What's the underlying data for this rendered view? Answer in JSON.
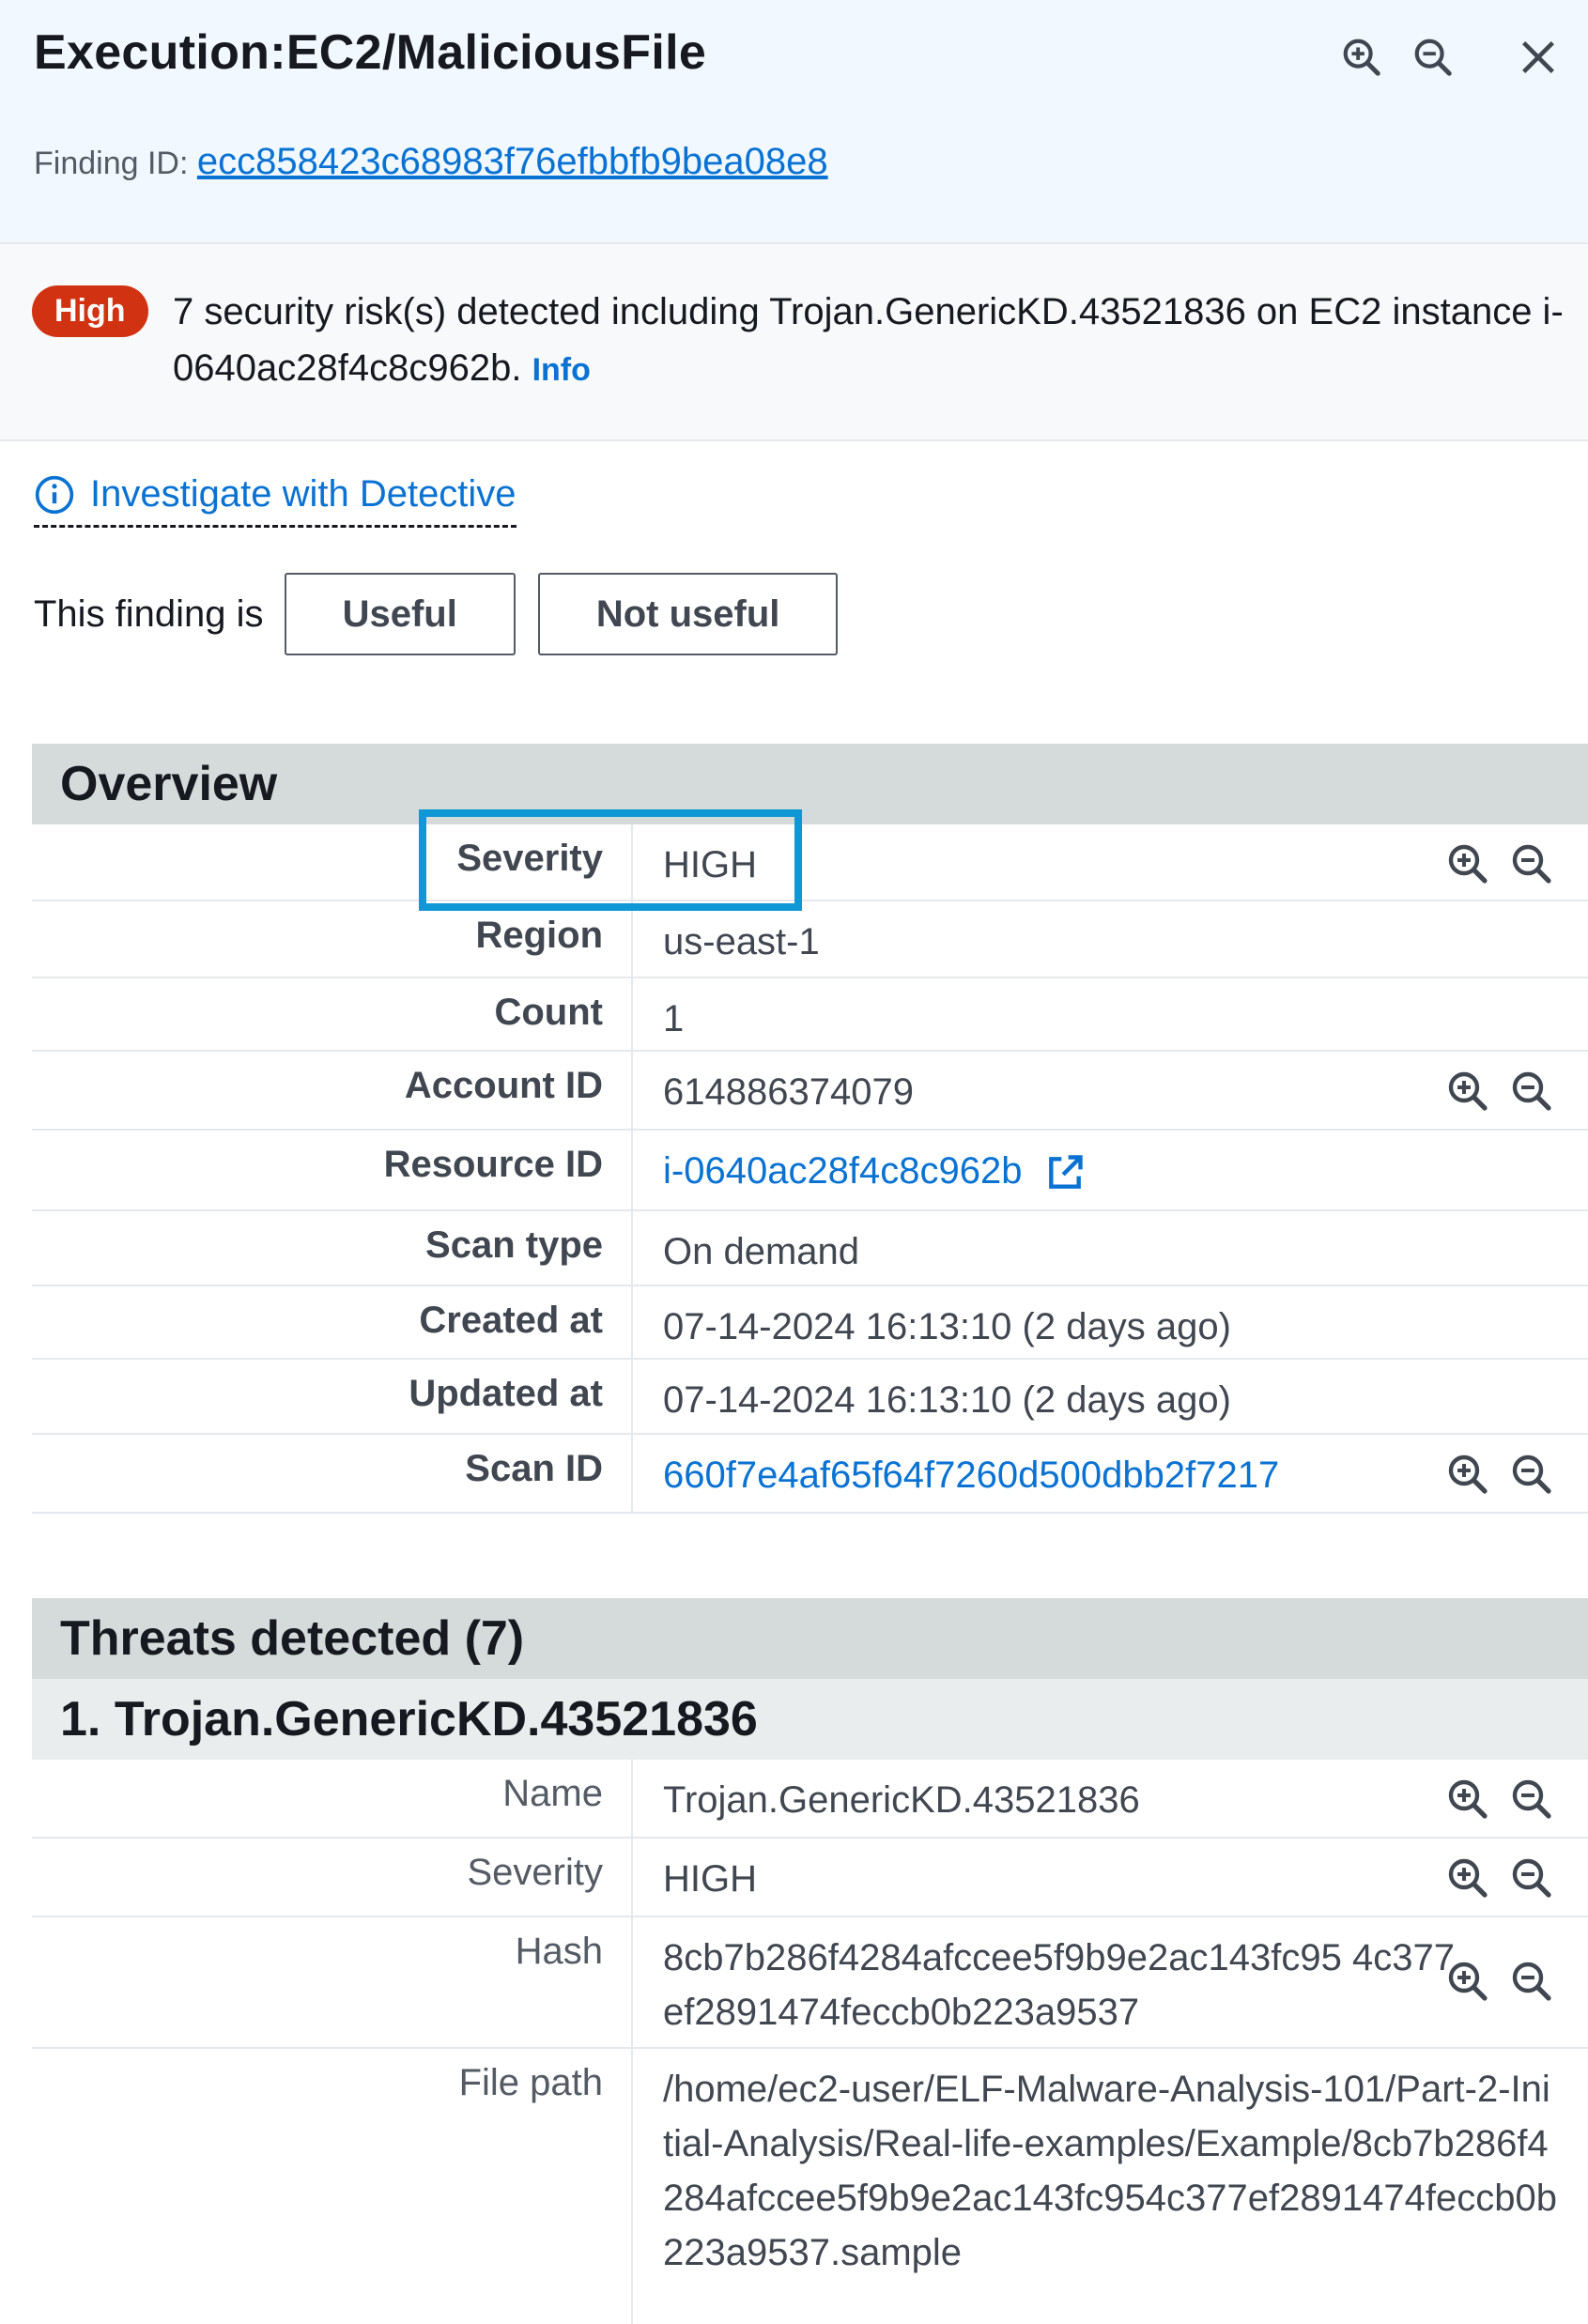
{
  "header": {
    "title": "Execution:EC2/MaliciousFile",
    "finding_id_label": "Finding ID: ",
    "finding_id": "ecc858423c68983f76efbbfb9bea08e8"
  },
  "alert": {
    "severity_badge": "High",
    "message": "7 security risk(s) detected including Trojan.GenericKD.43521836 on EC2 instance i-0640ac28f4c8c962b.",
    "info_link": "Info"
  },
  "detective": {
    "label": "Investigate with Detective"
  },
  "feedback": {
    "label": "This finding is",
    "useful": "Useful",
    "not_useful": "Not useful"
  },
  "overview": {
    "heading": "Overview",
    "rows": [
      {
        "key": "Severity",
        "value": "HIGH"
      },
      {
        "key": "Region",
        "value": "us-east-1"
      },
      {
        "key": "Count",
        "value": "1"
      },
      {
        "key": "Account ID",
        "value": "614886374079"
      },
      {
        "key": "Resource ID",
        "value": "i-0640ac28f4c8c962b"
      },
      {
        "key": "Scan type",
        "value": "On demand"
      },
      {
        "key": "Created at",
        "value": "07-14-2024 16:13:10 (2 days ago)"
      },
      {
        "key": "Updated at",
        "value": "07-14-2024 16:13:10 (2 days ago)"
      },
      {
        "key": "Scan ID",
        "value": "660f7e4af65f64f7260d500dbb2f7217"
      }
    ]
  },
  "threats": {
    "heading": "Threats detected (7)",
    "threat_1": {
      "heading": "1. Trojan.GenericKD.43521836",
      "rows": [
        {
          "key": "Name",
          "value": "Trojan.GenericKD.43521836"
        },
        {
          "key": "Severity",
          "value": "HIGH"
        },
        {
          "key": "Hash",
          "value": "8cb7b286f4284afccee5f9b9e2ac143fc95 4c377ef2891474feccb0b223a9537"
        },
        {
          "key": "File path",
          "value": "/home/ec2-user/ELF-Malware-Analysis-101/Part-2-Initial-Analysis/Real-life-examples/Example/8cb7b286f4284afccee5f9b9e2ac143fc954c377ef2891474feccb0b223a9537.sample"
        }
      ]
    }
  }
}
